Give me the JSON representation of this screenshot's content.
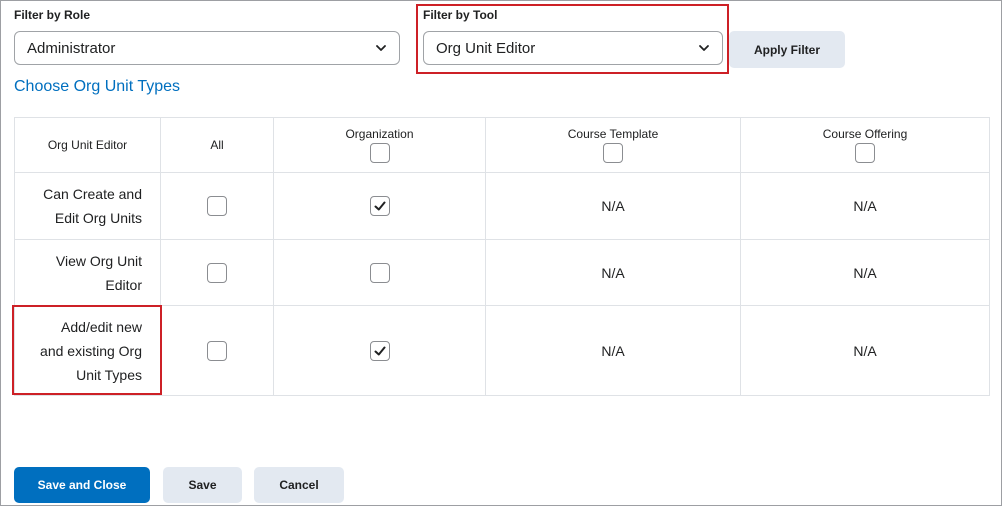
{
  "filters": {
    "role_label": "Filter by Role",
    "role_value": "Administrator",
    "tool_label": "Filter by Tool",
    "tool_value": "Org Unit Editor",
    "apply_label": "Apply Filter"
  },
  "link_choose": "Choose Org Unit Types",
  "table": {
    "corner": "Org Unit Editor",
    "columns": [
      "All",
      "Organization",
      "Course Template",
      "Course Offering"
    ],
    "rows": [
      {
        "label_lines": [
          "Can Create and",
          "Edit Org Units"
        ],
        "all": false,
        "organization": true,
        "course_template": "N/A",
        "course_offering": "N/A"
      },
      {
        "label_lines": [
          "View Org Unit",
          "Editor"
        ],
        "all": false,
        "organization": false,
        "course_template": "N/A",
        "course_offering": "N/A"
      },
      {
        "label_lines": [
          "Add/edit new",
          "and existing Org",
          "Unit Types"
        ],
        "all": false,
        "organization": true,
        "course_template": "N/A",
        "course_offering": "N/A"
      }
    ]
  },
  "footer": {
    "save_close": "Save and Close",
    "save": "Save",
    "cancel": "Cancel"
  },
  "colors": {
    "primary": "#006fbf",
    "highlight": "#cd2026"
  }
}
